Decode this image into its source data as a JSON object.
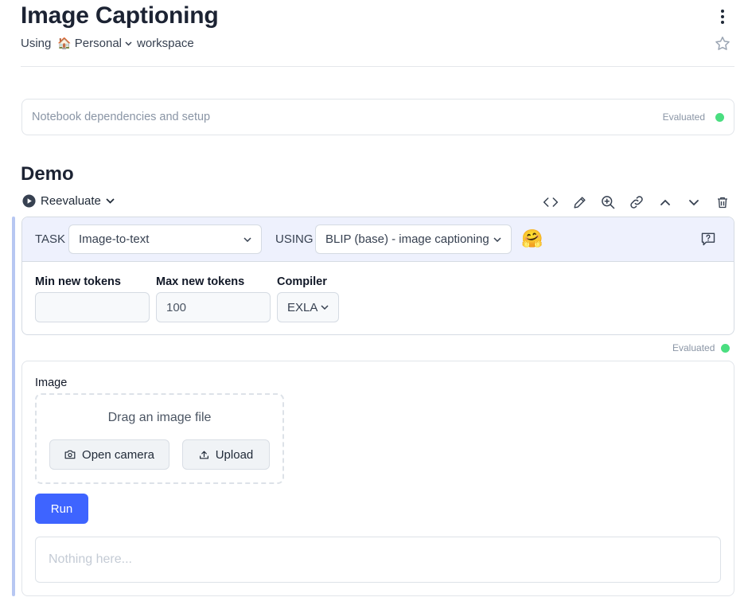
{
  "page": {
    "title": "Image Captioning",
    "subtitle_prefix": "Using",
    "workspace_emoji": "🏠",
    "workspace_name": "Personal",
    "subtitle_suffix": "workspace"
  },
  "setup_cell": {
    "label": "Notebook dependencies and setup",
    "status": "Evaluated",
    "status_color": "#4ade80"
  },
  "section": {
    "title": "Demo",
    "reevaluate_label": "Reevaluate",
    "toolbar_icons": [
      "code-icon",
      "pencil-icon",
      "zoom-in-icon",
      "link-icon",
      "chevron-up-icon",
      "chevron-down-icon",
      "trash-icon"
    ]
  },
  "smart_cell": {
    "task_label": "TASK",
    "task_value": "Image-to-text",
    "using_label": "USING",
    "model_value": "BLIP (base) - image captioning",
    "hf_emoji": "🤗",
    "min_tokens_label": "Min new tokens",
    "min_tokens_value": "",
    "max_tokens_label": "Max new tokens",
    "max_tokens_value": "100",
    "compiler_label": "Compiler",
    "compiler_value": "EXLA",
    "accent_color": "#eef1fd"
  },
  "output": {
    "status": "Evaluated",
    "image_label": "Image",
    "drop_text": "Drag an image file",
    "open_camera_label": "Open camera",
    "upload_label": "Upload",
    "run_label": "Run",
    "run_color": "#3e64ff",
    "result_placeholder": "Nothing here..."
  }
}
